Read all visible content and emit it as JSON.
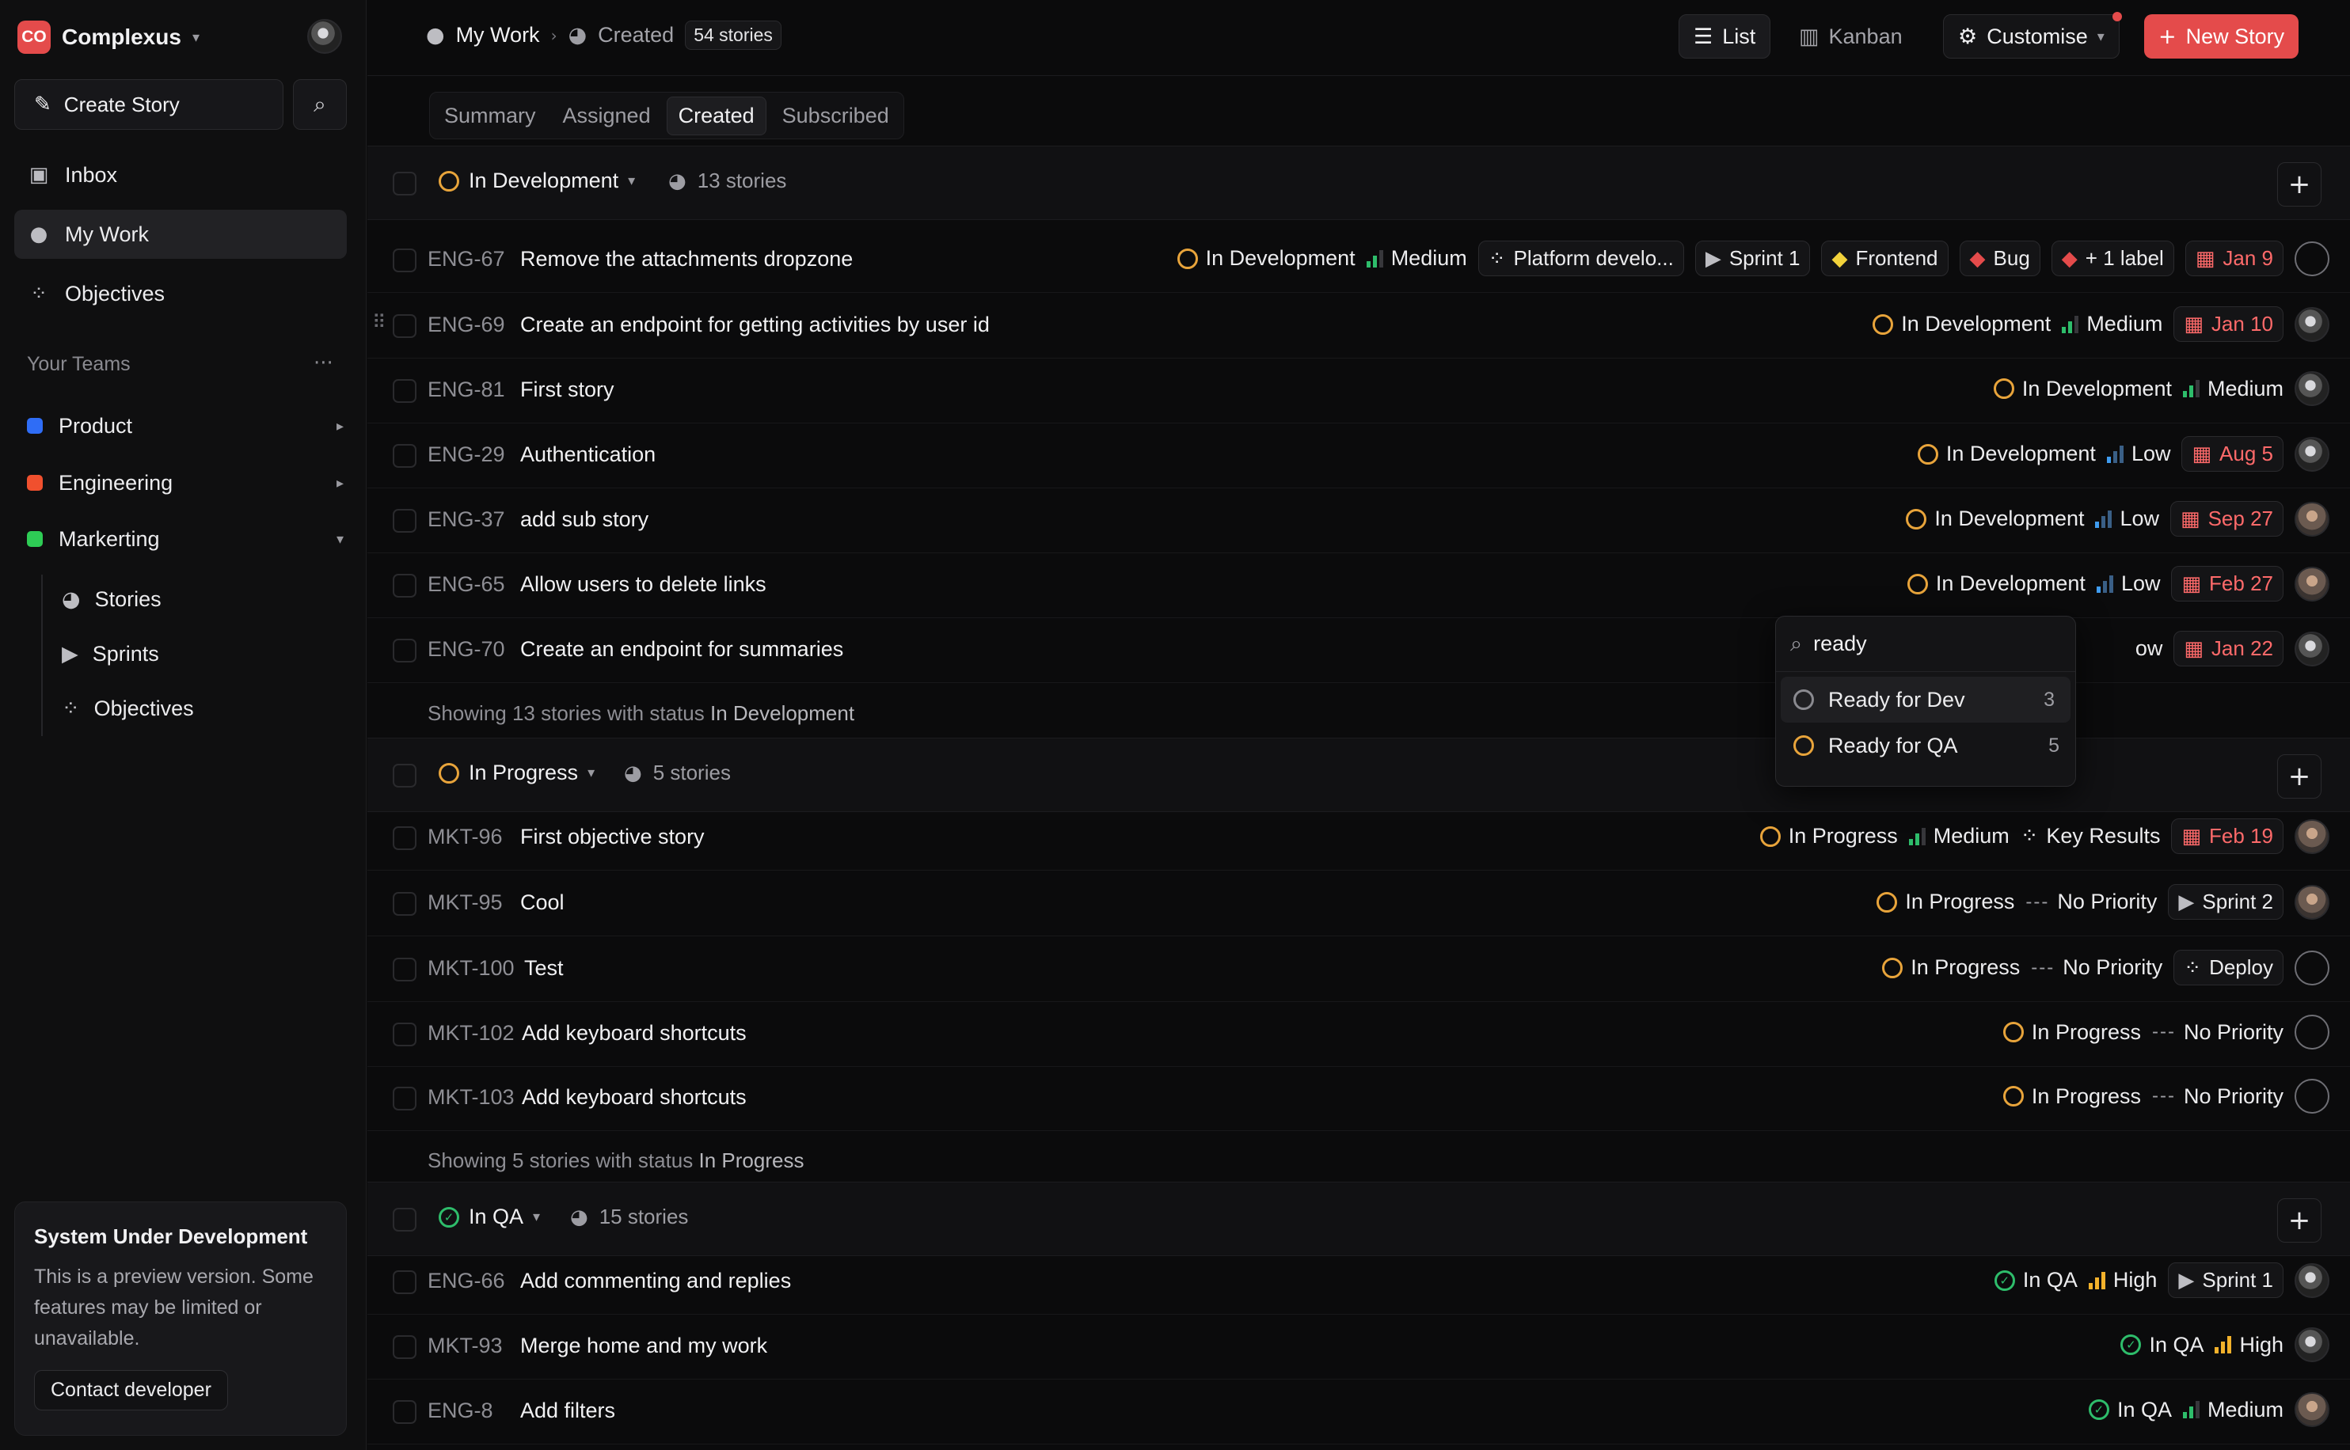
{
  "workspace": {
    "logo": "CO",
    "name": "Complexus"
  },
  "sidebar": {
    "create_story": "Create Story",
    "nav": [
      {
        "label": "Inbox",
        "icon": "inbox-icon"
      },
      {
        "label": "My Work",
        "icon": "user-icon"
      },
      {
        "label": "Objectives",
        "icon": "grid-icon"
      }
    ],
    "teams_label": "Your Teams",
    "teams": [
      {
        "label": "Product",
        "color": "#2f6df6"
      },
      {
        "label": "Engineering",
        "color": "#f0502e"
      },
      {
        "label": "Markerting",
        "color": "#2ecc55"
      }
    ],
    "sub_items": [
      {
        "label": "Stories",
        "icon": "stories-icon"
      },
      {
        "label": "Sprints",
        "icon": "play-icon"
      },
      {
        "label": "Objectives",
        "icon": "grid-icon"
      }
    ],
    "dev_card": {
      "title": "System Under Development",
      "text": "This is a preview version. Some features may be limited or unavailable.",
      "button": "Contact developer"
    }
  },
  "header": {
    "crumb_main": "My Work",
    "crumb_sub": "Created",
    "count": "54 stories",
    "list": "List",
    "kanban": "Kanban",
    "customise": "Customise",
    "new_story": "New Story"
  },
  "tabs": [
    "Summary",
    "Assigned",
    "Created",
    "Subscribed"
  ],
  "groups": {
    "dev": {
      "status": "In Development",
      "count": "13 stories",
      "footer_prefix": "Showing 13 stories with status",
      "footer_status": "In Development",
      "rows": [
        {
          "id": "ENG-67",
          "title": "Remove the attachments dropzone",
          "status": "In Development",
          "priority": "Medium",
          "objective": "Platform develo...",
          "sprint": "Sprint 1",
          "label1": "Frontend",
          "label2": "Bug",
          "more_labels": "+ 1 label",
          "date": "Jan 9"
        },
        {
          "id": "ENG-69",
          "title": "Create an endpoint for getting activities by user id",
          "status": "In Development",
          "priority": "Medium",
          "date": "Jan 10"
        },
        {
          "id": "ENG-81",
          "title": "First story",
          "status": "In Development",
          "priority": "Medium"
        },
        {
          "id": "ENG-29",
          "title": "Authentication",
          "status": "In Development",
          "priority": "Low",
          "date": "Aug 5"
        },
        {
          "id": "ENG-37",
          "title": "add sub story",
          "status": "In Development",
          "priority": "Low",
          "date": "Sep 27"
        },
        {
          "id": "ENG-65",
          "title": "Allow users to delete links",
          "status": "In Development",
          "priority": "Low",
          "date": "Feb 27"
        },
        {
          "id": "ENG-70",
          "title": "Create an endpoint for summaries",
          "priority_partial": "ow",
          "date": "Jan 22"
        }
      ]
    },
    "progress": {
      "status": "In Progress",
      "count": "5 stories",
      "footer_prefix": "Showing 5 stories with status",
      "footer_status": "In Progress",
      "rows": [
        {
          "id": "MKT-96",
          "title": "First objective story",
          "status": "In Progress",
          "priority": "Medium",
          "objective": "Key Results",
          "date": "Feb 19"
        },
        {
          "id": "MKT-95",
          "title": "Cool",
          "status": "In Progress",
          "priority": "No Priority",
          "sprint": "Sprint 2"
        },
        {
          "id": "MKT-100",
          "title": "Test",
          "status": "In Progress",
          "priority": "No Priority",
          "objective": "Deploy"
        },
        {
          "id": "MKT-102",
          "title": "Add keyboard shortcuts",
          "status": "In Progress",
          "priority": "No Priority"
        },
        {
          "id": "MKT-103",
          "title": "Add keyboard shortcuts",
          "status": "In Progress",
          "priority": "No Priority"
        }
      ]
    },
    "qa": {
      "status": "In QA",
      "count": "15 stories",
      "rows": [
        {
          "id": "ENG-66",
          "title": "Add commenting and replies",
          "status": "In QA",
          "priority": "High",
          "sprint": "Sprint 1"
        },
        {
          "id": "MKT-93",
          "title": "Merge home and my work",
          "status": "In QA",
          "priority": "High"
        },
        {
          "id": "ENG-8",
          "title": "Add filters",
          "status": "In QA",
          "priority": "Medium"
        }
      ]
    }
  },
  "status_popup": {
    "query": "ready",
    "options": [
      {
        "label": "Ready for Dev",
        "count": "3"
      },
      {
        "label": "Ready for QA",
        "count": "5"
      }
    ]
  }
}
